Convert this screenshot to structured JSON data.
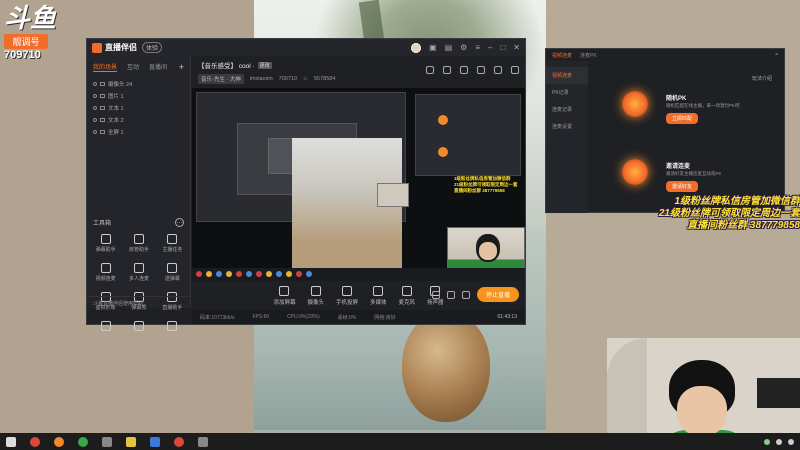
{
  "colors": {
    "accent": "#f26c2a",
    "live_button": "#f7941d",
    "overlay_text": "#ffe33a"
  },
  "overlay_logo": {
    "mark": "斗鱼",
    "badge": "靓调号",
    "room_number": "709710"
  },
  "window": {
    "app_name": "直播伴侣",
    "version_badge": "体验",
    "room_title": "【音乐感受】 cool ·",
    "room_tag": "更改",
    "category": "音乐·先生 · 大神",
    "username": "imxiaoxin",
    "room_id": "709710",
    "hot_value": "5578584"
  },
  "sidebar": {
    "tabs": [
      "我的场景",
      "互动",
      "直播间"
    ],
    "scenes": [
      {
        "label": "摄像头 24"
      },
      {
        "label": "图片 1"
      },
      {
        "label": "文本 1"
      },
      {
        "label": "文本 2"
      },
      {
        "label": "全屏 1"
      }
    ],
    "tools_title": "工具箱",
    "tools": [
      {
        "label": "弹幕助手",
        "icon": "comment-icon"
      },
      {
        "label": "房管助手",
        "icon": "shield-icon"
      },
      {
        "label": "主播任务",
        "icon": "task-icon"
      },
      {
        "label": "视频连麦",
        "icon": "video-link-icon"
      },
      {
        "label": "多人连麦",
        "icon": "multi-link-icon"
      },
      {
        "label": "送弹幕",
        "icon": "barrage-icon"
      },
      {
        "label": "虚拟形象",
        "icon": "avatar-icon"
      },
      {
        "label": "弹幕秀",
        "icon": "show-icon"
      },
      {
        "label": "直播助手",
        "icon": "assistant-icon"
      },
      {
        "label": "PK",
        "icon": "pk-icon"
      },
      {
        "label": "",
        "icon": "more-tool-icon"
      },
      {
        "label": "",
        "icon": "more-tool-icon"
      }
    ],
    "footer": "斗鱼直播伴侣使用帮助"
  },
  "control_bar": {
    "buttons": [
      {
        "label": "添加屏幕",
        "icon": "screen-icon"
      },
      {
        "label": "摄像头",
        "icon": "camera-icon"
      },
      {
        "label": "手机投屏",
        "icon": "phone-icon"
      },
      {
        "label": "多媒体",
        "icon": "media-icon"
      },
      {
        "label": "麦克风",
        "icon": "mic-icon"
      },
      {
        "label": "扬声器",
        "icon": "speaker-icon"
      }
    ],
    "live_button": "停止直播"
  },
  "status_bar": {
    "bitrate": "码率:10773kb/s",
    "fps": "FPS:60",
    "cpu": "CPU:9%(33%)",
    "drop": "丢帧:0%",
    "network": "网络:良好",
    "time": "01:43:13"
  },
  "nested_overlay_text": [
    "1级粉丝牌私信房管加微信群",
    "21级粉丝牌可领取限定周边一套",
    "直播间粉丝群 387779858"
  ],
  "pk_panel": {
    "tabs": [
      "视频连麦",
      "连麦PK"
    ],
    "close": "×",
    "nav": [
      "视频连麦",
      "PK记录",
      "连麦记录",
      "连麦设置"
    ],
    "side_link": "玩法介绍",
    "cards": [
      {
        "title": "随机PK",
        "desc": "随机匹配在线主播，来一场激烈PK吧",
        "button": "立即匹配"
      },
      {
        "title": "邀请连麦",
        "desc": "邀请好友主播连麦互动或PK",
        "button": "邀请好友"
      }
    ]
  },
  "overlay_text": [
    "1级粉丝牌私信房管加微信群",
    "21级粉丝牌可领取限定周边一套",
    "直播间粉丝群 387779858"
  ],
  "taskbar": {
    "items": [
      "windows-start-icon",
      "app-red-icon",
      "app-orange-icon",
      "app-green-icon",
      "app-gray-icon",
      "app-yellow-icon",
      "app-blue-icon",
      "app-red2-icon",
      "app-gray2-icon"
    ]
  }
}
